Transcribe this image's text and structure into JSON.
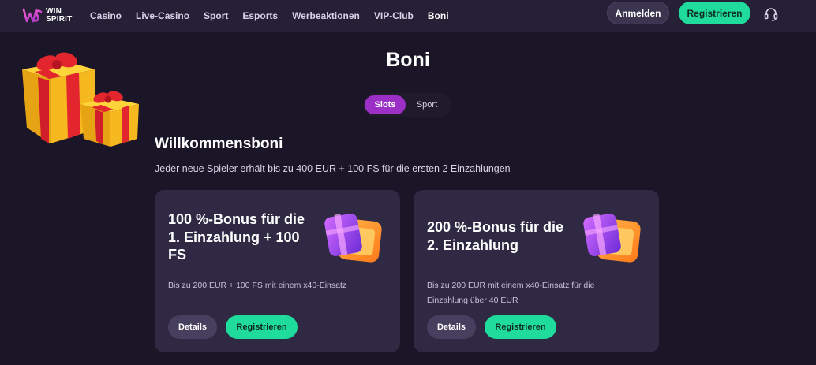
{
  "header": {
    "logo_text_line1": "WIN",
    "logo_text_line2": "SPIRIT",
    "nav": [
      {
        "label": "Casino"
      },
      {
        "label": "Live-Casino"
      },
      {
        "label": "Sport"
      },
      {
        "label": "Esports"
      },
      {
        "label": "Werbeaktionen"
      },
      {
        "label": "VIP-Club"
      },
      {
        "label": "Boni",
        "active": true
      }
    ],
    "login_label": "Anmelden",
    "register_label": "Registrieren",
    "support_icon": "headset-icon"
  },
  "page": {
    "title": "Boni",
    "tabs": [
      {
        "label": "Slots",
        "active": true
      },
      {
        "label": "Sport"
      }
    ],
    "section_title": "Willkommensboni",
    "section_subtitle": "Jeder neue Spieler erhält bis zu 400 EUR + 100 FS für die ersten 2 Einzahlungen"
  },
  "cards": [
    {
      "title": "100 %-Bonus für die 1. Einzahlung + 100 FS",
      "description": "Bis zu 200 EUR + 100 FS mit einem x40-Einsatz",
      "details_label": "Details",
      "register_label": "Registrieren"
    },
    {
      "title": "200 %-Bonus für die 2. Einzahlung",
      "description": "Bis zu 200 EUR mit einem x40-Einsatz für die Einzahlung über 40 EUR",
      "details_label": "Details",
      "register_label": "Registrieren"
    }
  ],
  "colors": {
    "background": "#1b1627",
    "topbar": "#252035",
    "card": "#2f2944",
    "accent_green": "#1fdc9c",
    "accent_purple": "#9b2fc6"
  }
}
